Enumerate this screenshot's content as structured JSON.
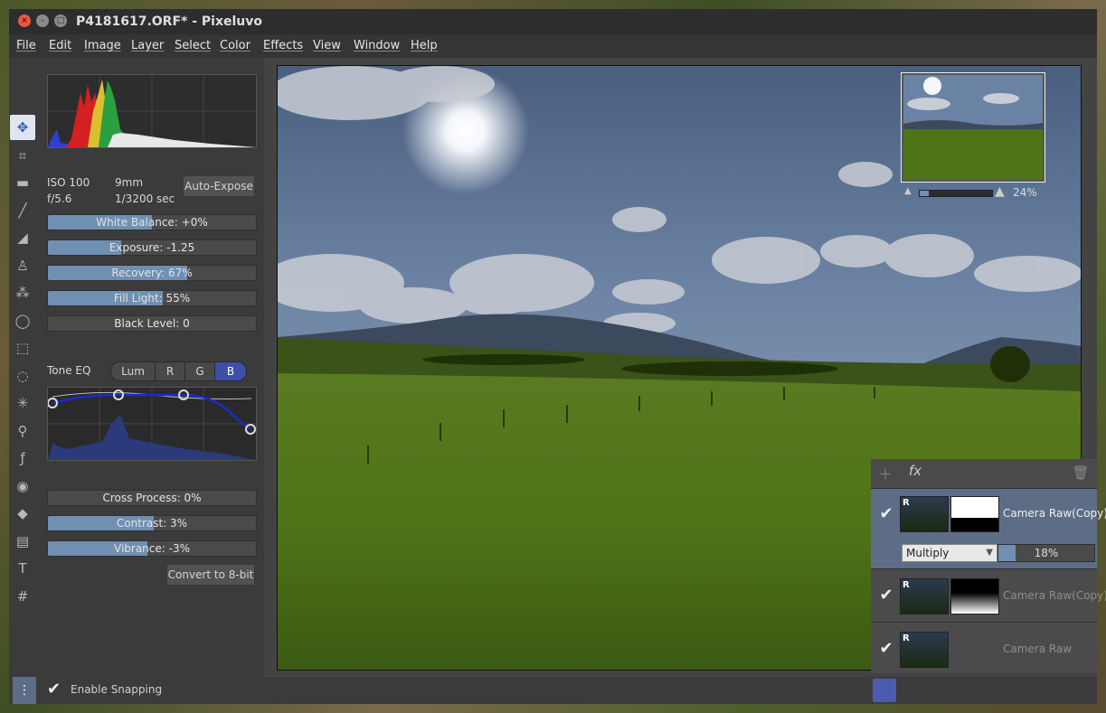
{
  "window": {
    "title": "P4181617.ORF* - Pixeluvo",
    "close": "×",
    "min": "–",
    "max": "□"
  },
  "menu": [
    "File",
    "Edit",
    "Image",
    "Layer",
    "Select",
    "Color",
    "Effects",
    "View",
    "Window",
    "Help"
  ],
  "tools": [
    {
      "name": "move-tool",
      "glyph": "✥",
      "active": true
    },
    {
      "name": "crop-tool",
      "glyph": "⌗"
    },
    {
      "name": "straighten-tool",
      "glyph": "▬"
    },
    {
      "name": "brush-tool",
      "glyph": "╱"
    },
    {
      "name": "eraser-tool",
      "glyph": "◢"
    },
    {
      "name": "clone-stamp-tool",
      "glyph": "♙"
    },
    {
      "name": "healing-tool",
      "glyph": "⁂"
    },
    {
      "name": "lasso-tool",
      "glyph": "◯"
    },
    {
      "name": "rect-select-tool",
      "glyph": "⬚"
    },
    {
      "name": "ellipse-select-tool",
      "glyph": "◌"
    },
    {
      "name": "magic-wand-tool",
      "glyph": "✳"
    },
    {
      "name": "color-picker-tool",
      "glyph": "⚲"
    },
    {
      "name": "effect-brush-tool",
      "glyph": "ƒ"
    },
    {
      "name": "redeye-tool",
      "glyph": "◉"
    },
    {
      "name": "fill-tool",
      "glyph": "◆"
    },
    {
      "name": "gradient-tool",
      "glyph": "▤"
    },
    {
      "name": "text-tool",
      "glyph": "T"
    },
    {
      "name": "grid-tool",
      "glyph": "#"
    }
  ],
  "exif": {
    "iso": "ISO 100",
    "focal": "9mm",
    "aperture": "f/5.6",
    "shutter": "1/3200 sec"
  },
  "auto_expose": "Auto-Expose",
  "sliders_top": [
    {
      "label": "White Balance: +0%",
      "fill": 0.5
    },
    {
      "label": "Exposure: -1.25",
      "fill": 0.35
    },
    {
      "label": "Recovery: 67%",
      "fill": 0.67
    },
    {
      "label": "Fill Light: 55%",
      "fill": 0.55
    },
    {
      "label": "Black Level: 0",
      "fill": 0.0
    }
  ],
  "tone_eq": {
    "label": "Tone EQ",
    "channels": [
      "Lum",
      "R",
      "G",
      "B"
    ],
    "selected": "B"
  },
  "sliders_bottom": [
    {
      "label": "Cross Process: 0%",
      "fill": 0.0
    },
    {
      "label": "Contrast: 3%",
      "fill": 0.51
    },
    {
      "label": "Vibrance: -3%",
      "fill": 0.48
    }
  ],
  "convert_button": "Convert to 8-bit",
  "navigator": {
    "zoom": "24%",
    "zoom_fraction": 0.12
  },
  "layers": [
    {
      "name": "Camera Raw(Copy)",
      "checked": true,
      "selected": true,
      "blend": "Multiply",
      "opacity": "18%",
      "opacity_fraction": 0.18
    },
    {
      "name": "Camera Raw(Copy)",
      "checked": true,
      "selected": false
    },
    {
      "name": "Camera Raw",
      "checked": true,
      "selected": false
    }
  ],
  "layer_badge": "R",
  "snapping": {
    "label": "Enable Snapping",
    "checked": true
  },
  "colors": {
    "accent": "#6f8fb3",
    "selected_seg": "#3d4fa8",
    "panel": "#3b3b3b"
  }
}
